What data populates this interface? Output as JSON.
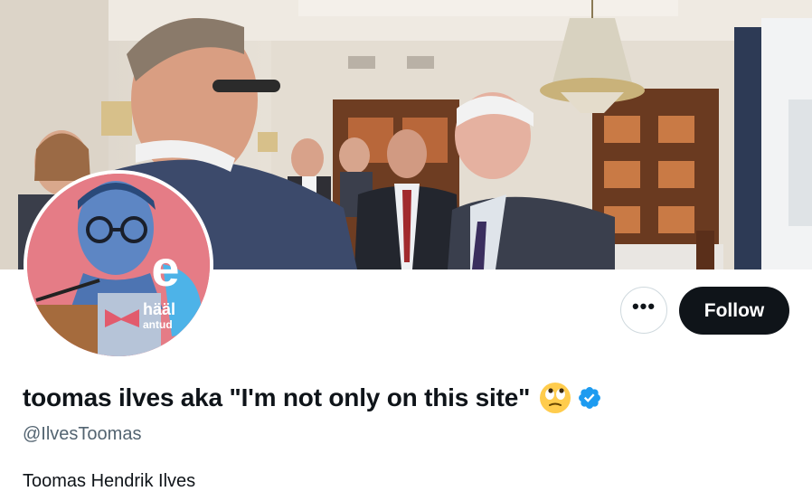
{
  "profile": {
    "display_name": "toomas ilves aka \"I'm not only on this site\"",
    "name_emoji": "face-with-rolling-eyes-icon",
    "verified": true,
    "handle": "@IlvesToomas",
    "bio": "Toomas Hendrik Ilves"
  },
  "avatar": {
    "badge_letter": "e",
    "badge_line1": "hääl",
    "badge_line2": "antud"
  },
  "actions": {
    "more_label": "•••",
    "follow_label": "Follow"
  },
  "colors": {
    "follow_bg": "#0f1419",
    "verified_blue": "#1d9bf0",
    "handle_gray": "#536471",
    "avatar_bg": "#e57c86"
  }
}
